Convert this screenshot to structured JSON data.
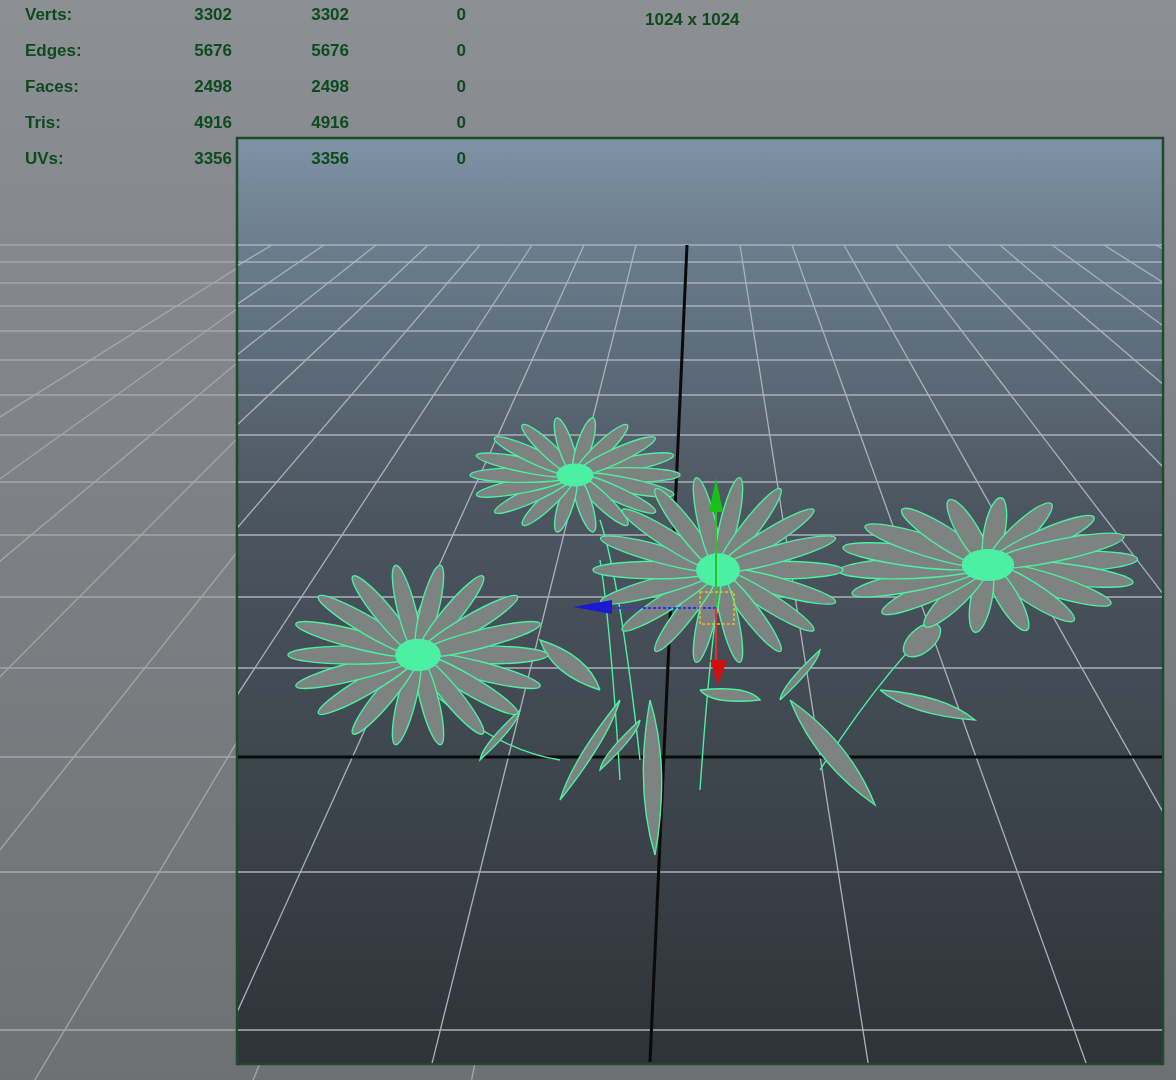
{
  "hud": {
    "rows": [
      {
        "label": "Verts:",
        "values": [
          "3302",
          "3302",
          "0"
        ]
      },
      {
        "label": "Edges:",
        "values": [
          "5676",
          "5676",
          "0"
        ]
      },
      {
        "label": "Faces:",
        "values": [
          "2498",
          "2498",
          "0"
        ]
      },
      {
        "label": "Tris:",
        "values": [
          "4916",
          "4916",
          "0"
        ]
      },
      {
        "label": "UVs:",
        "values": [
          "3356",
          "3356",
          "0"
        ]
      }
    ]
  },
  "resolution": "1024 x 1024"
}
